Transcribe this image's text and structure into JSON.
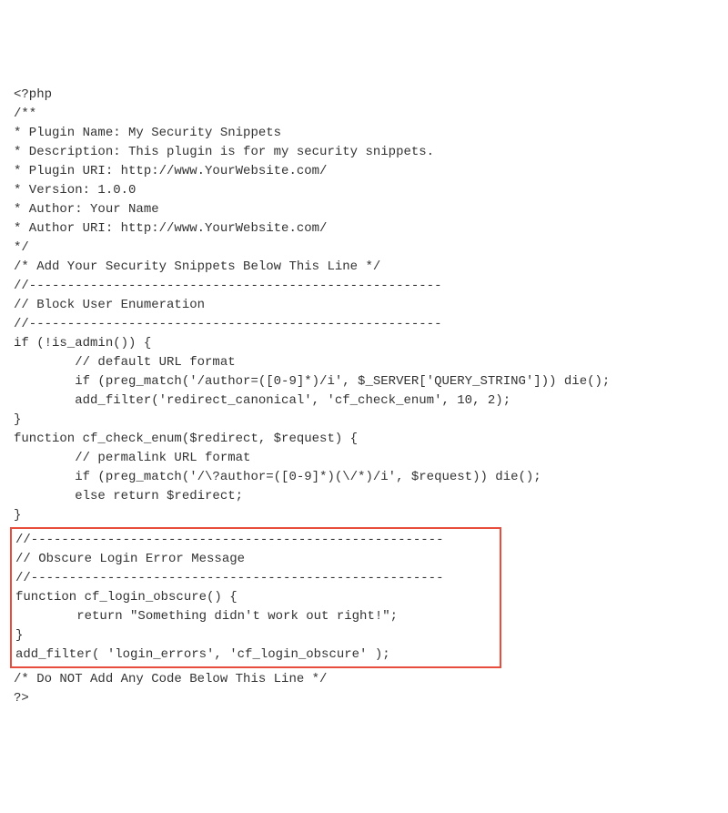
{
  "code": {
    "lines": [
      "<?php",
      "/**",
      "* Plugin Name: My Security Snippets",
      "* Description: This plugin is for my security snippets.",
      "* Plugin URI: http://www.YourWebsite.com/",
      "* Version: 1.0.0",
      "* Author: Your Name",
      "* Author URI: http://www.YourWebsite.com/",
      "*/",
      "",
      "/* Add Your Security Snippets Below This Line */",
      "",
      "//------------------------------------------------------",
      "// Block User Enumeration",
      "//------------------------------------------------------",
      "if (!is_admin()) {",
      "        // default URL format",
      "        if (preg_match('/author=([0-9]*)/i', $_SERVER['QUERY_STRING'])) die();",
      "        add_filter('redirect_canonical', 'cf_check_enum', 10, 2);",
      "}",
      "function cf_check_enum($redirect, $request) {",
      "        // permalink URL format",
      "        if (preg_match('/\\?author=([0-9]*)(\\/*)/i', $request)) die();",
      "        else return $redirect;",
      "",
      "}",
      ""
    ],
    "highlighted_lines": [
      "//------------------------------------------------------",
      "// Obscure Login Error Message",
      "//------------------------------------------------------",
      "function cf_login_obscure() {",
      "        return \"Something didn't work out right!\";",
      "}",
      "add_filter( 'login_errors', 'cf_login_obscure' );"
    ],
    "footer_lines": [
      "",
      "/* Do NOT Add Any Code Below This Line */",
      "?>"
    ]
  }
}
